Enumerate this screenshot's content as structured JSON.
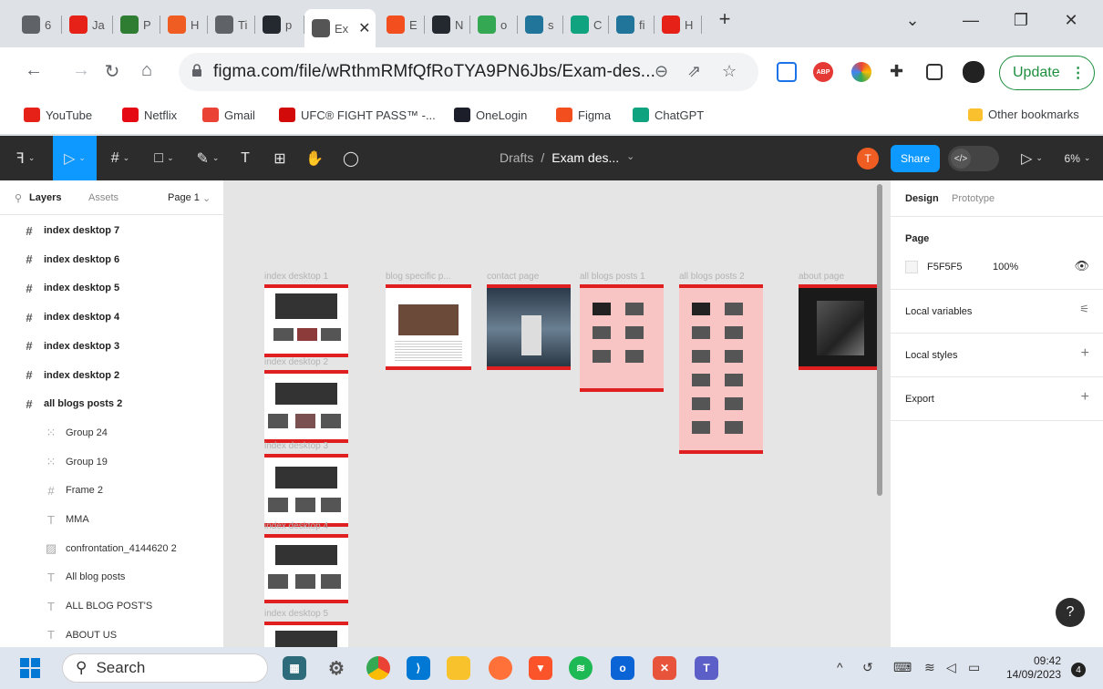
{
  "browser": {
    "tabs": [
      {
        "favicon": "figma-drive-icon",
        "label": "6",
        "color": "#5f6368"
      },
      {
        "favicon": "youtube-icon",
        "label": "Ja",
        "color": "#e62117"
      },
      {
        "favicon": "project-icon",
        "label": "P",
        "color": "#2e7d32"
      },
      {
        "favicon": "hub-icon",
        "label": "H",
        "color": "#ef5d23"
      },
      {
        "favicon": "globe-icon",
        "label": "Ti",
        "color": "#5f6368"
      },
      {
        "favicon": "github-icon",
        "label": "p",
        "color": "#24292f"
      },
      {
        "favicon": "figma-icon",
        "label": "Ex",
        "color": "#555555"
      },
      {
        "favicon": "figma-icon",
        "label": "E",
        "color": "#f24e1e"
      },
      {
        "favicon": "github-icon",
        "label": "N",
        "color": "#24292f"
      },
      {
        "favicon": "circle-icon",
        "label": "o",
        "color": "#34a853"
      },
      {
        "favicon": "wordpress-icon",
        "label": "s",
        "color": "#21759b"
      },
      {
        "favicon": "chatgpt-icon",
        "label": "C",
        "color": "#10a37f"
      },
      {
        "favicon": "wordpress-icon",
        "label": "fi",
        "color": "#21759b"
      },
      {
        "favicon": "youtube-icon",
        "label": "H",
        "color": "#e62117"
      }
    ],
    "new_tab": "+",
    "url": "figma.com/file/wRthmRMfQfRoTYA9PN6Jbs/Exam-des...",
    "update_label": "Update",
    "bookmarks": [
      {
        "label": "YouTube",
        "icon": "youtube-icon",
        "color": "#e62117"
      },
      {
        "label": "Netflix",
        "icon": "netflix-icon",
        "color": "#e50914"
      },
      {
        "label": "Gmail",
        "icon": "gmail-icon",
        "color": "#ea4335"
      },
      {
        "label": "UFC® FIGHT PASS™ -...",
        "icon": "ufc-icon",
        "color": "#d20a0a"
      },
      {
        "label": "OneLogin",
        "icon": "onelogin-icon",
        "color": "#1c1f2a"
      },
      {
        "label": "Figma",
        "icon": "figma-icon",
        "color": "#f24e1e"
      },
      {
        "label": "ChatGPT",
        "icon": "chatgpt-icon",
        "color": "#10a37f"
      }
    ],
    "other_bookmarks": "Other bookmarks"
  },
  "figma": {
    "breadcrumb_parent": "Drafts",
    "file_name": "Exam des...",
    "avatar_initial": "T",
    "share_label": "Share",
    "zoom": "6%",
    "left_tabs": {
      "layers": "Layers",
      "assets": "Assets",
      "page": "Page 1"
    },
    "layers": [
      {
        "label": "index desktop 7",
        "kind": "frame",
        "level": "top"
      },
      {
        "label": "index desktop 6",
        "kind": "frame",
        "level": "top"
      },
      {
        "label": "index desktop 5",
        "kind": "frame",
        "level": "top"
      },
      {
        "label": "index desktop 4",
        "kind": "frame",
        "level": "top"
      },
      {
        "label": "index desktop 3",
        "kind": "frame",
        "level": "top"
      },
      {
        "label": "index desktop 2",
        "kind": "frame",
        "level": "top"
      },
      {
        "label": "all blogs posts 2",
        "kind": "frame",
        "level": "top"
      },
      {
        "label": "Group 24",
        "kind": "group",
        "level": "sub"
      },
      {
        "label": "Group 19",
        "kind": "group",
        "level": "sub"
      },
      {
        "label": "Frame 2",
        "kind": "frame",
        "level": "sub"
      },
      {
        "label": "MMA",
        "kind": "text",
        "level": "sub"
      },
      {
        "label": "confrontation_4144620 2",
        "kind": "image",
        "level": "sub"
      },
      {
        "label": "All blog posts",
        "kind": "text",
        "level": "sub"
      },
      {
        "label": "ALL BLOG POST'S",
        "kind": "text",
        "level": "sub"
      },
      {
        "label": "ABOUT US",
        "kind": "text",
        "level": "sub"
      }
    ],
    "canvas_frames": {
      "index1": "index desktop 1",
      "index2": "index desktop 2",
      "index3": "index desktop 3",
      "index4": "index desktop 4",
      "index5": "index desktop 5",
      "blog_specific": "blog specific p...",
      "contact": "contact page",
      "all_blogs_1": "all blogs posts 1",
      "all_blogs_2": "all blogs posts 2",
      "about": "about page"
    },
    "right_panel": {
      "tabs": {
        "design": "Design",
        "prototype": "Prototype"
      },
      "page_title": "Page",
      "page_color": "F5F5F5",
      "page_opacity": "100%",
      "local_variables": "Local variables",
      "local_styles": "Local styles",
      "export": "Export"
    },
    "help": "?"
  },
  "taskbar": {
    "search_label": "Search",
    "time": "09:42",
    "date": "14/09/2023",
    "notification_count": "4"
  }
}
